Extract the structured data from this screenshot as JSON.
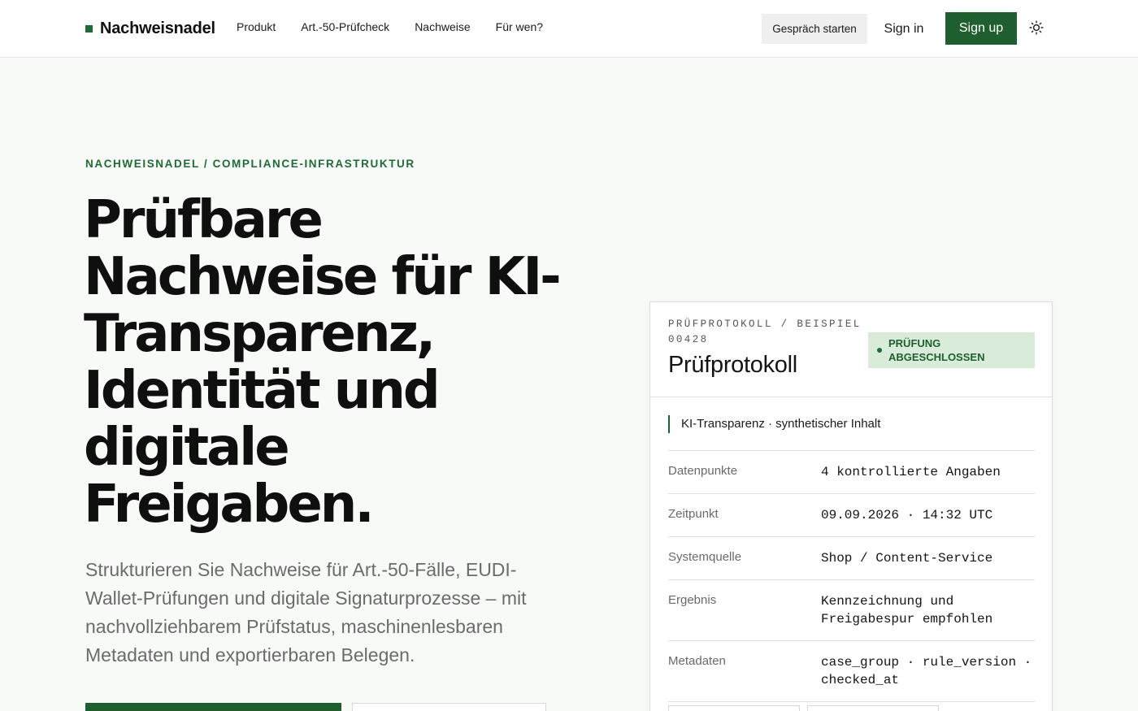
{
  "header": {
    "brand": "Nachweisnadel",
    "nav": [
      "Produkt",
      "Art.-50-Prüfcheck",
      "Nachweise",
      "Für wen?"
    ],
    "talk_label": "Gespräch starten",
    "signin_label": "Sign in",
    "signup_label": "Sign up",
    "theme_icon": "sun-icon"
  },
  "hero": {
    "eyebrow": "NACHWEISNADEL / COMPLIANCE-INFRASTRUKTUR",
    "headline": "Prüfbare Nachweise für KI-Transparenz, Identität und digitale Freigaben.",
    "lead": "Strukturieren Sie Nachweise für Art.-50-Fälle, EUDI-Wallet-Prüfungen und digitale Signaturprozesse – mit nachvollziehbarem Prüfstatus, maschinenlesbaren Metadaten und exportierbaren Belegen."
  },
  "card": {
    "kicker": "PRÜFPROTOKOLL / BEISPIEL 00428",
    "title": "Prüfprotokoll",
    "status": "PRÜFUNG ABGESCHLOSSEN",
    "case": "KI-Transparenz · synthetischer Inhalt",
    "rows": [
      {
        "key": "Datenpunkte",
        "value": "4 kontrollierte Angaben"
      },
      {
        "key": "Zeitpunkt",
        "value": "09.09.2026 · 14:32 UTC"
      },
      {
        "key": "Systemquelle",
        "value": "Shop / Content-Service"
      },
      {
        "key": "Ergebnis",
        "value": "Kennzeichnung und Freigabespur empfohlen"
      },
      {
        "key": "Metadaten",
        "value": "case_group · rule_version · checked_at"
      }
    ]
  },
  "colors": {
    "accent": "#1f5e2f",
    "accent_text": "#1f6b35",
    "badge_bg": "#d8ecd9",
    "page_bg": "#f8faf8"
  }
}
